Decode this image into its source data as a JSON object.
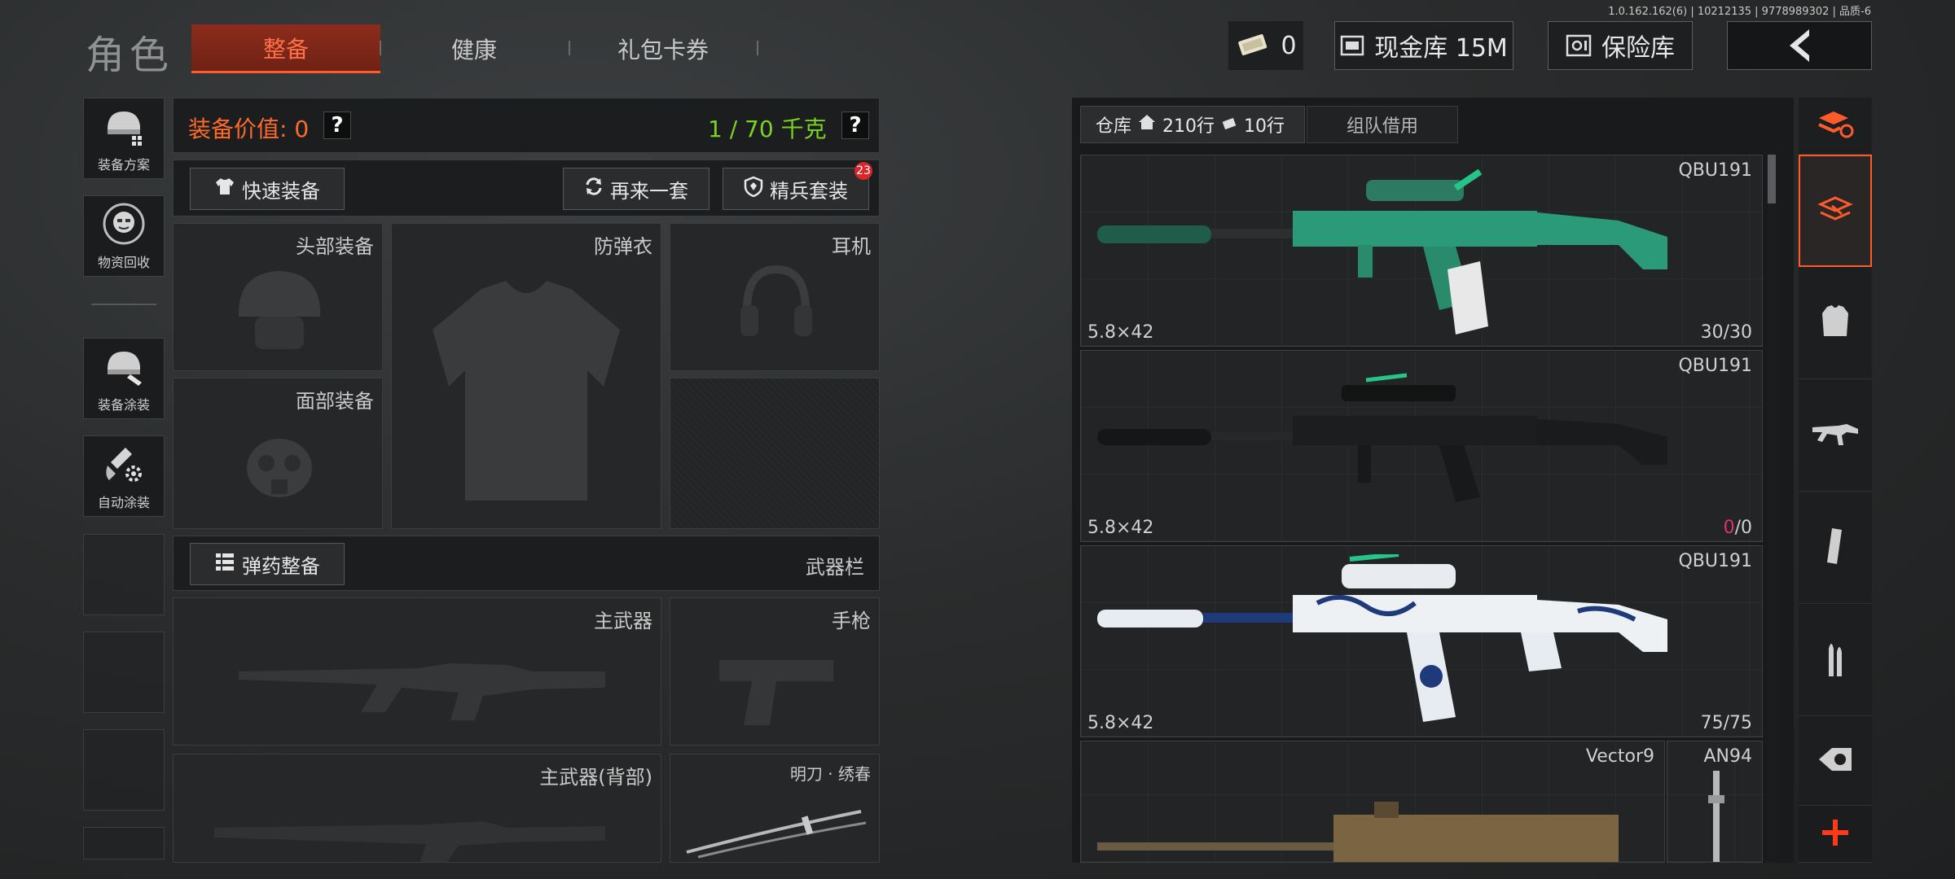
{
  "version": "1.0.162.162(6) | 10212135 | 9778989302 | 品质-6",
  "title": "角色",
  "tabs": [
    {
      "label": "整备",
      "active": true
    },
    {
      "label": "健康",
      "active": false
    },
    {
      "label": "礼包卡券",
      "active": false
    }
  ],
  "header": {
    "ticket_count": "0",
    "cash_label": "现金库 15M",
    "vault_label": "保险库",
    "back_icon": "chevron-left-icon"
  },
  "sidebar": {
    "items": [
      {
        "label": "装备方案",
        "icon": "helmet-grid-icon"
      },
      {
        "label": "物资回收",
        "icon": "recycle-face-icon"
      },
      {
        "label": "装备涂装",
        "icon": "helmet-paint-icon"
      },
      {
        "label": "自动涂装",
        "icon": "brush-gear-icon"
      }
    ]
  },
  "loadout": {
    "value_label": "装备价值: 0",
    "weight_label": "1 / 70 千克",
    "help": "?",
    "quick_equip": "快速装备",
    "redo_set": "再来一套",
    "elite_set": "精兵套装",
    "elite_badge": "23",
    "slots": {
      "head": "头部装备",
      "armor": "防弹衣",
      "headset": "耳机",
      "face": "面部装备",
      "ammo_btn": "弹药整备",
      "weapon_bar": "武器栏",
      "primary": "主武器",
      "pistol": "手枪",
      "primary_back": "主武器(背部)",
      "melee": "明刀 · 绣春"
    }
  },
  "warehouse": {
    "tab_storage": "仓库",
    "rows_label": "210行",
    "rows2_label": "10行",
    "tab_team": "组队借用",
    "items": [
      {
        "name": "QBU191",
        "caliber": "5.8×42",
        "ammo": "30/30",
        "ammo_color": "#d0d0d0",
        "skin": "green"
      },
      {
        "name": "QBU191",
        "caliber": "5.8×42",
        "ammo_a": "0",
        "ammo_b": "/0",
        "ammo_color": "#e0336a",
        "skin": "black"
      },
      {
        "name": "QBU191",
        "caliber": "5.8×42",
        "ammo": "75/75",
        "ammo_color": "#d0d0d0",
        "skin": "white-blue"
      },
      {
        "name": "Vector9",
        "name2": "AN94",
        "skin": "brown"
      }
    ]
  },
  "categories": [
    "layers-refresh-icon",
    "all-items-icon",
    "vest-icon",
    "rifle-icon",
    "magazine-icon",
    "bullet-icon",
    "scope-icon",
    "plus-icon"
  ],
  "colors": {
    "accent": "#ff5a2a",
    "value_orange": "#ff6a2a",
    "weight_green": "#7ed321",
    "ammo_empty": "#e0336a"
  }
}
